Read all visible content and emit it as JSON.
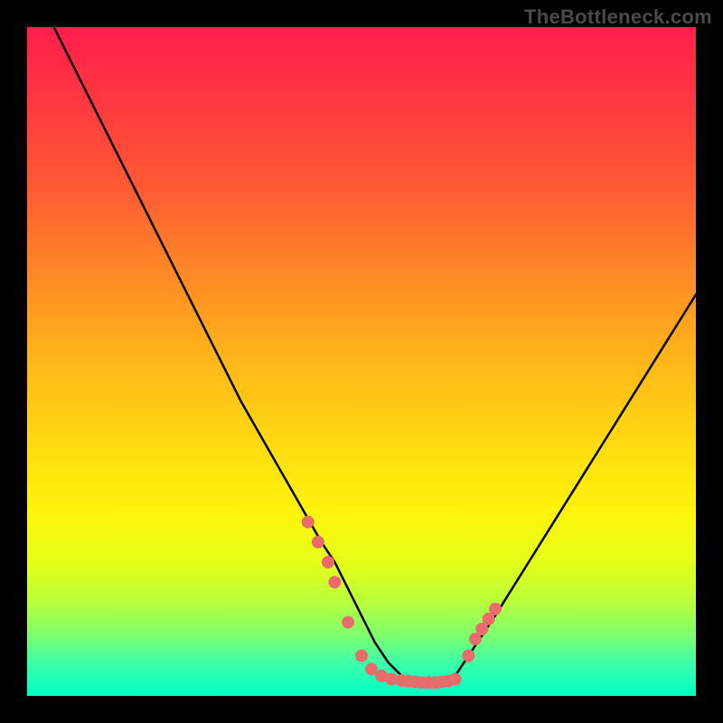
{
  "watermark": "TheBottleneck.com",
  "chart_data": {
    "type": "line",
    "title": "",
    "xlabel": "",
    "ylabel": "",
    "xlim": [
      0,
      100
    ],
    "ylim": [
      0,
      100
    ],
    "series": [
      {
        "name": "curve",
        "x": [
          4,
          8,
          12,
          16,
          20,
          24,
          28,
          32,
          36,
          40,
          44,
          46,
          48,
          50,
          52,
          54,
          56,
          58,
          60,
          62,
          64,
          66,
          70,
          75,
          80,
          85,
          90,
          95,
          100
        ],
        "values": [
          100,
          92,
          84,
          76,
          68,
          60,
          52,
          44,
          37,
          30,
          23,
          20,
          16,
          12,
          8,
          5,
          3,
          2,
          2,
          2,
          3,
          6,
          12,
          20,
          28,
          36,
          44,
          52,
          60
        ]
      },
      {
        "name": "markers",
        "x": [
          42,
          43.5,
          45,
          46,
          48,
          50,
          51.5,
          53,
          54.5,
          56,
          57,
          58,
          59,
          60,
          61,
          62,
          63,
          64,
          66,
          67,
          68,
          69,
          70
        ],
        "values": [
          26,
          23,
          20,
          17,
          11,
          6,
          4,
          3,
          2.5,
          2.3,
          2.2,
          2.1,
          2,
          2,
          2,
          2.1,
          2.2,
          2.5,
          6,
          8.5,
          10,
          11.5,
          13
        ]
      }
    ],
    "markers_color": "#e96b6b",
    "curve_color": "#000000"
  }
}
